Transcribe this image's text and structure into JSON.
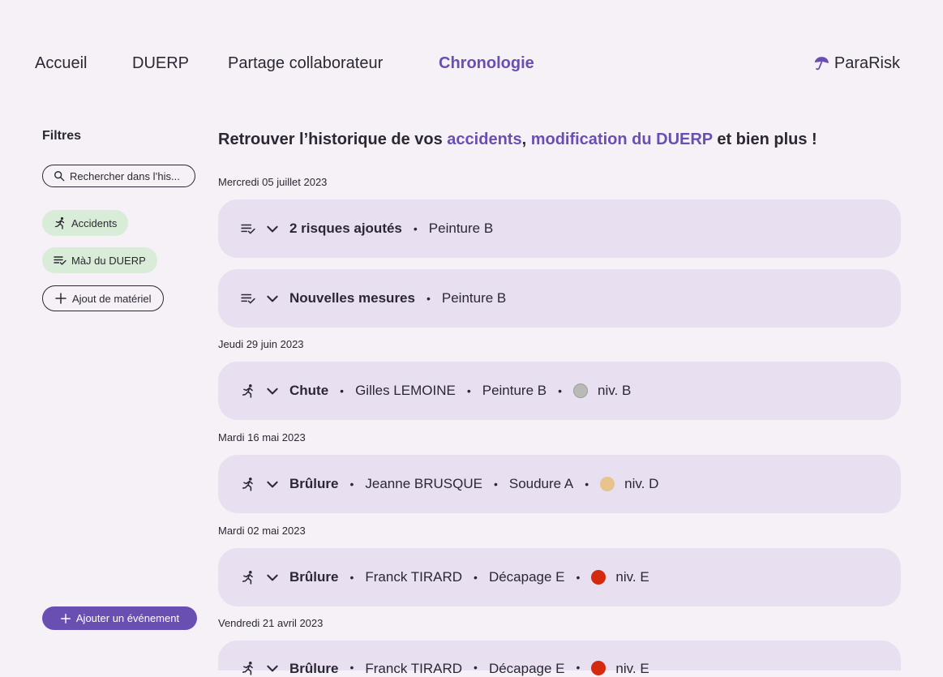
{
  "nav": {
    "items": [
      "Accueil",
      "DUERP",
      "Partage collaborateur",
      "Chronologie"
    ],
    "active": "Chronologie",
    "brand": "ParaRisk"
  },
  "sidebar": {
    "title": "Filtres",
    "search_placeholder": "Rechercher dans l’his...",
    "chips": [
      "Accidents",
      "MàJ du DUERP",
      "Ajout de matériel"
    ],
    "add_event": "Ajouter un événement"
  },
  "main": {
    "title_prefix": "Retrouver l’historique de vos ",
    "title_hl1": "accidents",
    "title_comma": ", ",
    "title_hl2": "modification du DUERP",
    "title_suffix": " et bien plus !"
  },
  "timeline": [
    {
      "date": "Mercredi 05 juillet 2023",
      "events": [
        {
          "type": "duerp",
          "title": "2 risques ajoutés",
          "fields": [
            "Peinture B"
          ]
        },
        {
          "type": "duerp",
          "title": "Nouvelles mesures",
          "fields": [
            "Peinture B"
          ]
        }
      ]
    },
    {
      "date": "Jeudi 29 juin 2023",
      "events": [
        {
          "type": "accident",
          "title": "Chute",
          "fields": [
            "Gilles LEMOINE",
            "Peinture B"
          ],
          "level": "niv. B"
        }
      ]
    },
    {
      "date": "Mardi 16 mai 2023",
      "events": [
        {
          "type": "accident",
          "title": "Brûlure",
          "fields": [
            "Jeanne BRUSQUE",
            "Soudure A"
          ],
          "level": "niv. D"
        }
      ]
    },
    {
      "date": "Mardi 02 mai 2023",
      "events": [
        {
          "type": "accident",
          "title": "Brûlure",
          "fields": [
            "Franck TIRARD",
            "Décapage E"
          ],
          "level": "niv. E"
        }
      ]
    },
    {
      "date": "Vendredi 21 avril 2023",
      "events": [
        {
          "type": "accident",
          "title": "Brûlure",
          "fields": [
            "Franck TIRARD",
            "Décapage E"
          ],
          "level": "niv. E"
        }
      ]
    }
  ],
  "colors": {
    "accent": "#6a4fb3",
    "card": "#e8dff0",
    "chip_green": "#d9ecd8",
    "level_b": "#b9b9b5",
    "level_d": "#e8c48c",
    "level_e": "#d62a10"
  }
}
